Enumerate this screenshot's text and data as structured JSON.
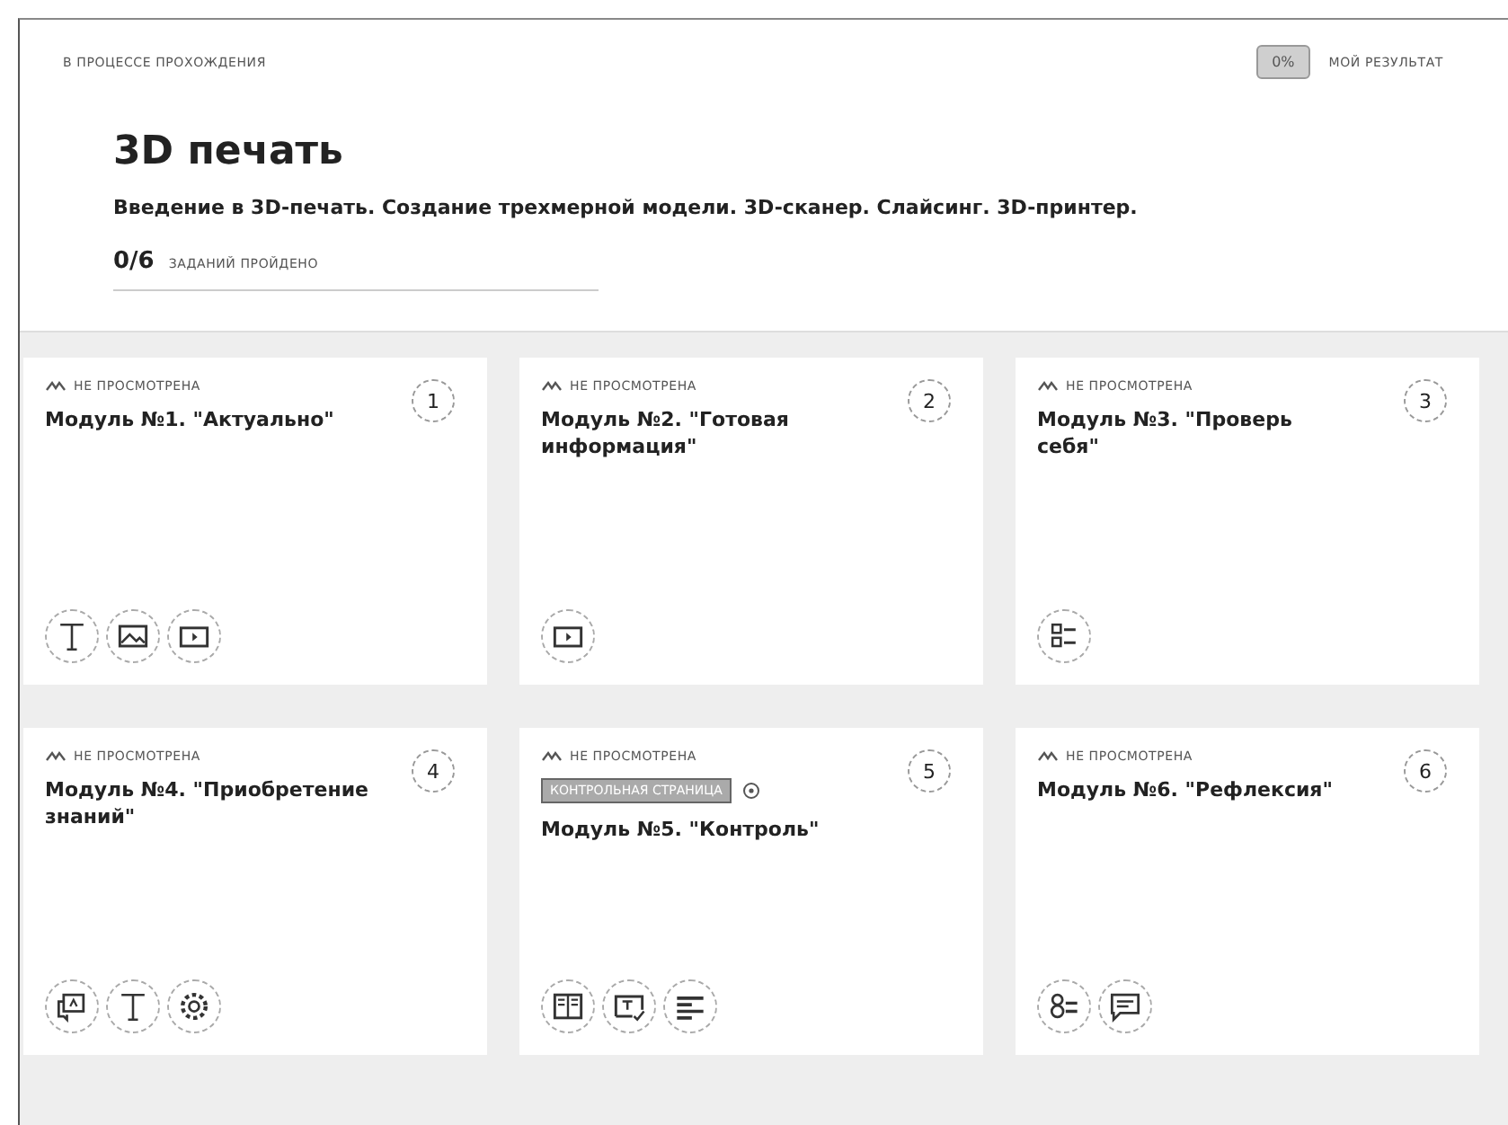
{
  "header": {
    "status": "В ПРОЦЕССЕ ПРОХОЖДЕНИЯ",
    "result_badge": "0%",
    "result_label": "МОЙ РЕЗУЛЬТАТ"
  },
  "course": {
    "title": "3D печать",
    "description": "Введение в 3D-печать. Создание трехмерной модели. 3D-сканер. Слайсинг. 3D-принтер.",
    "progress_count": "0/6",
    "progress_label": "ЗАДАНИЙ ПРОЙДЕНО",
    "level": 0
  },
  "modules": [
    {
      "status": "НЕ ПРОСМОТРЕНА",
      "number": "1",
      "title": "Модуль №1. \"Актуально\"",
      "icons": [
        {
          "kind": "text"
        },
        {
          "kind": "image"
        },
        {
          "kind": "video"
        }
      ]
    },
    {
      "status": "НЕ ПРОСМОТРЕНА",
      "number": "2",
      "title": "Модуль №2. \"Готовая информация\"",
      "icons": [
        {
          "kind": "video"
        }
      ]
    },
    {
      "status": "НЕ ПРОСМОТРЕНА",
      "number": "3",
      "title": "Модуль №3. \"Проверь себя\"",
      "icons": [
        {
          "kind": "checklist"
        }
      ]
    },
    {
      "status": "НЕ ПРОСМОТРЕНА",
      "number": "4",
      "title": "Модуль №4. \"Приобретение знаний\"",
      "icons": [
        {
          "kind": "slides"
        },
        {
          "kind": "text"
        },
        {
          "kind": "settings"
        }
      ]
    },
    {
      "status": "НЕ ПРОСМОТРЕНА",
      "number": "5",
      "tag": "КОНТРОЛЬНАЯ СТРАНИЦА",
      "title": "Модуль №5. \"Контроль\"",
      "icons": [
        {
          "kind": "columns"
        },
        {
          "kind": "textedit"
        },
        {
          "kind": "form"
        }
      ]
    },
    {
      "status": "НЕ ПРОСМОТРЕНА",
      "number": "6",
      "title": "Модуль №6. \"Рефлексия\"",
      "icons": [
        {
          "kind": "quiz"
        },
        {
          "kind": "comment"
        }
      ]
    }
  ]
}
